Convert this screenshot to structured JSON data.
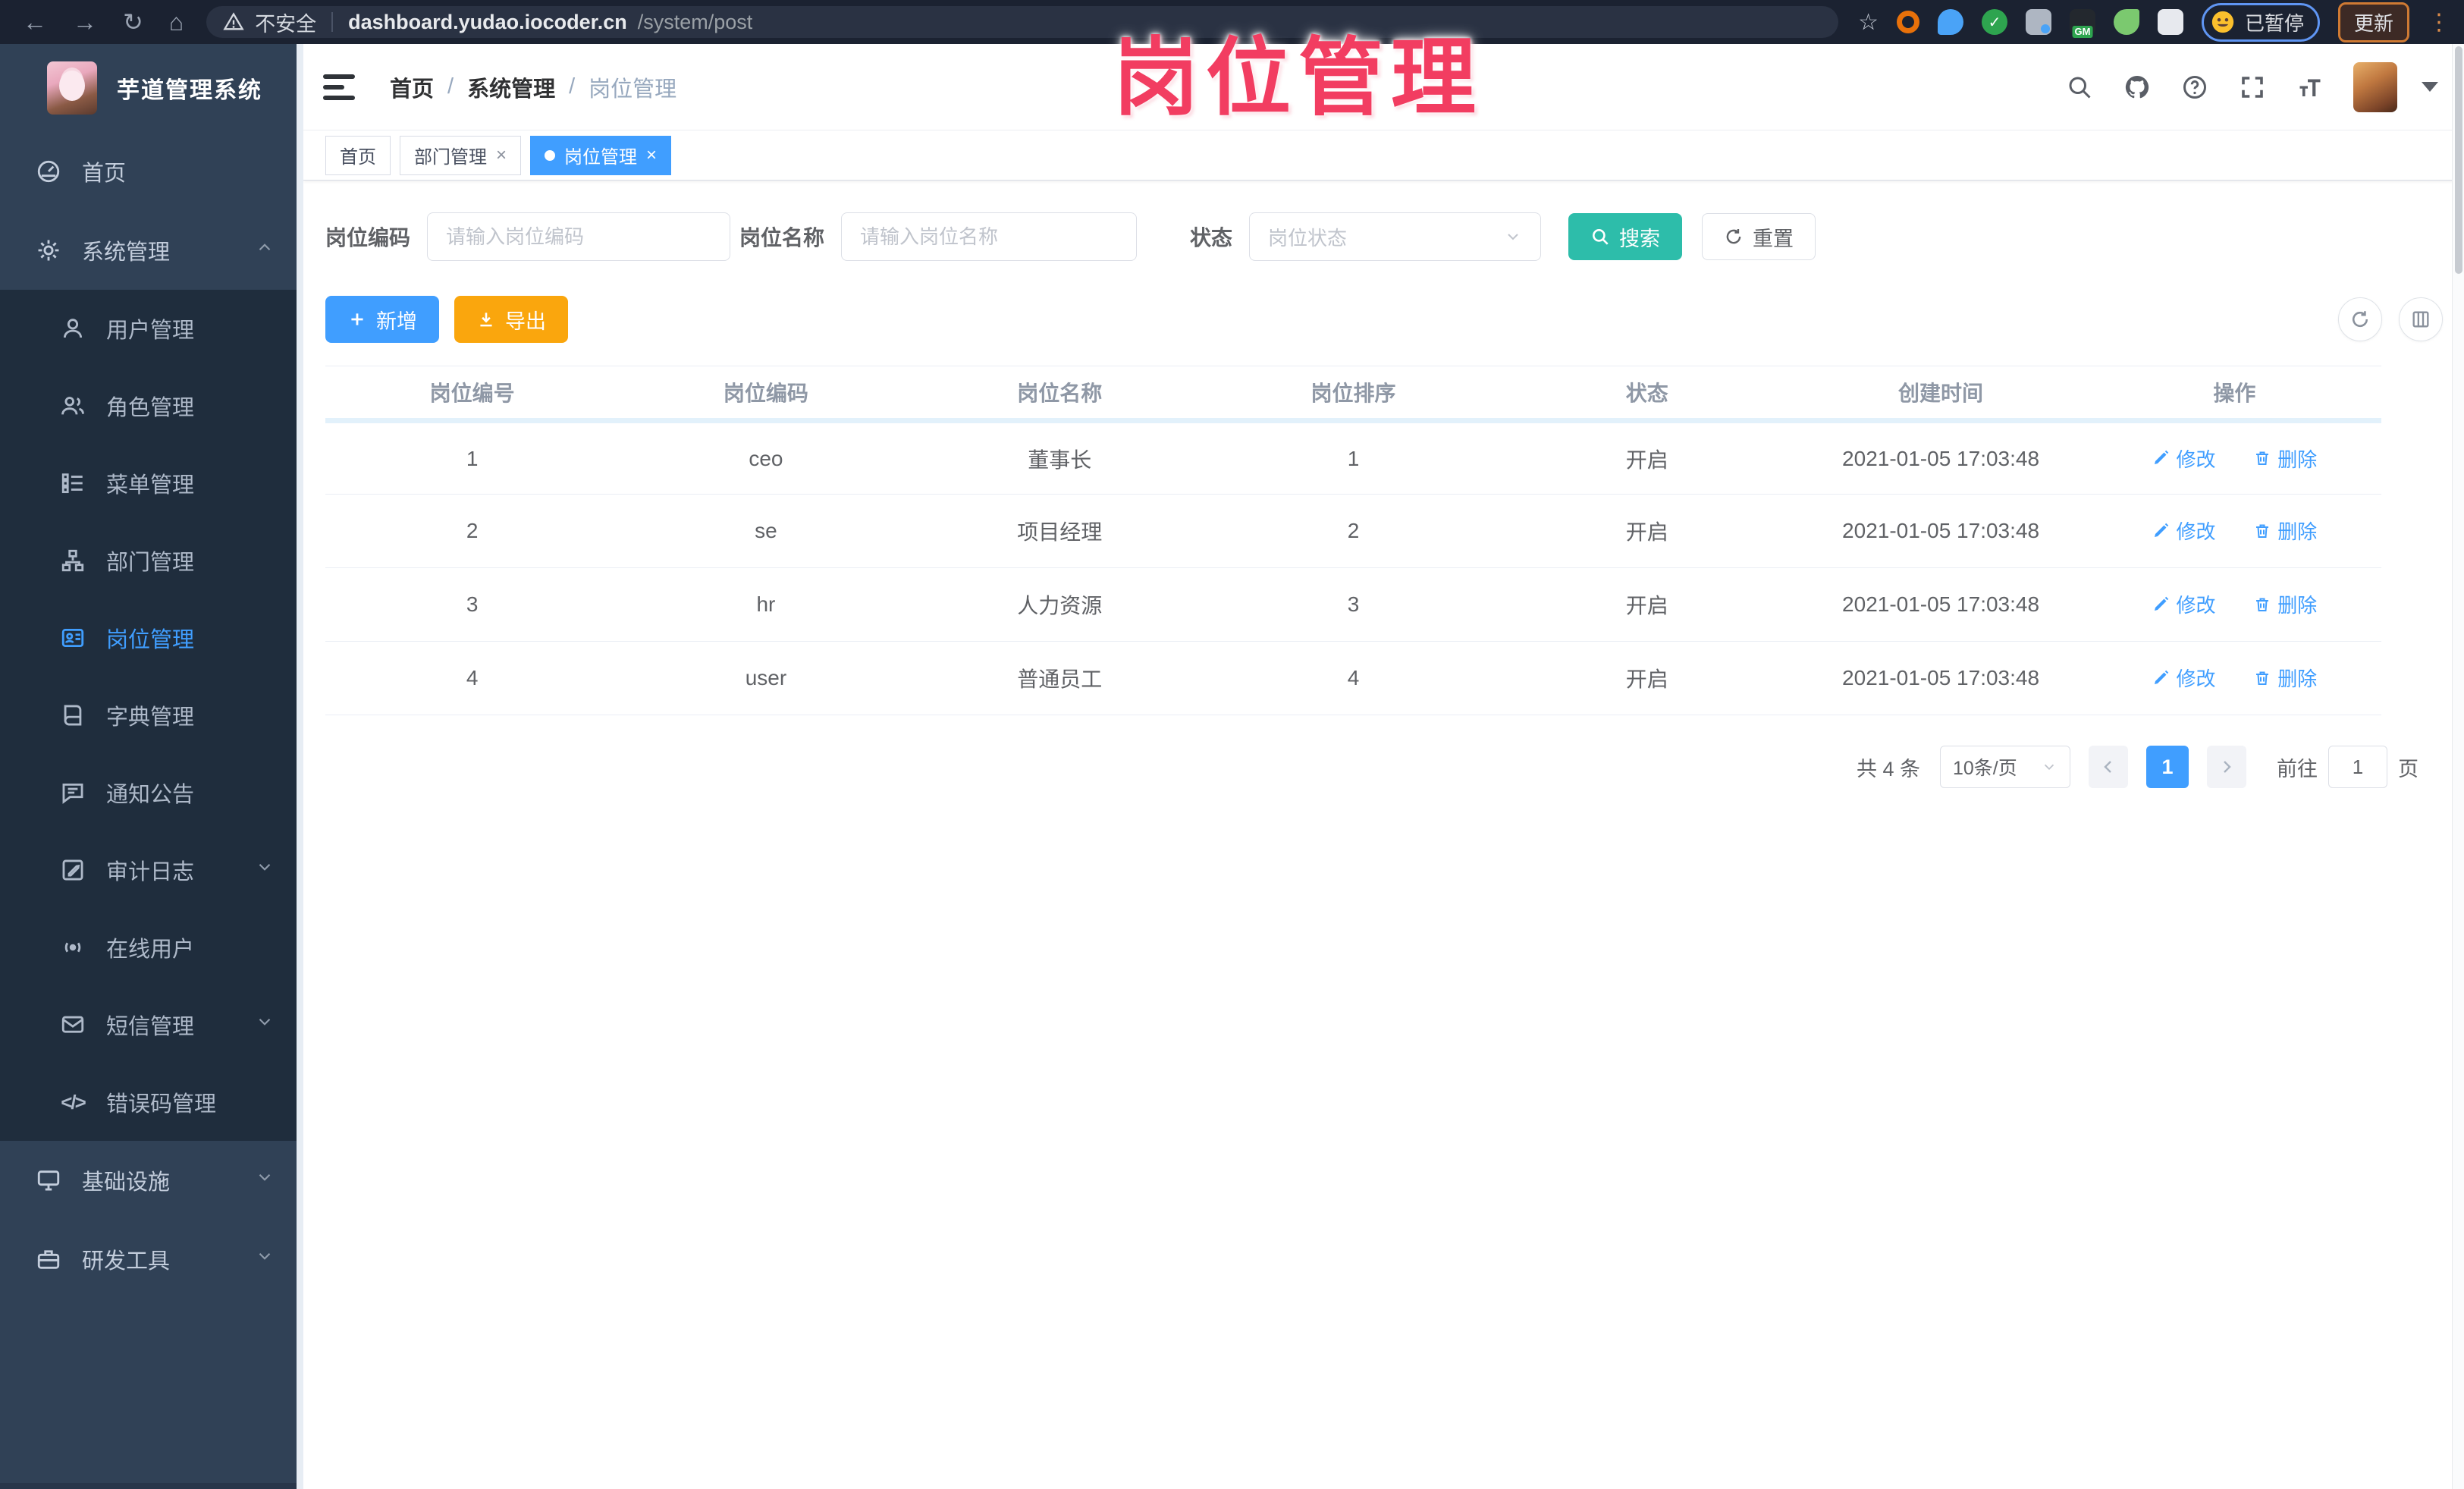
{
  "browser": {
    "security_label": "不安全",
    "url_host": "dashboard.yudao.iocoder.cn",
    "url_path": "/system/post",
    "gm_badge": "GM",
    "paused_label": "已暂停",
    "update_label": "更新"
  },
  "overlay_title": "岗位管理",
  "sidebar": {
    "app_title": "芋道管理系统",
    "items": [
      {
        "label": "首页"
      },
      {
        "label": "系统管理"
      },
      {
        "label": "用户管理"
      },
      {
        "label": "角色管理"
      },
      {
        "label": "菜单管理"
      },
      {
        "label": "部门管理"
      },
      {
        "label": "岗位管理"
      },
      {
        "label": "字典管理"
      },
      {
        "label": "通知公告"
      },
      {
        "label": "审计日志"
      },
      {
        "label": "在线用户"
      },
      {
        "label": "短信管理"
      },
      {
        "label": "错误码管理"
      },
      {
        "label": "基础设施"
      },
      {
        "label": "研发工具"
      }
    ]
  },
  "breadcrumb": {
    "items": [
      "首页",
      "系统管理",
      "岗位管理"
    ],
    "separator": "/"
  },
  "tabs": {
    "close_glyph": "×",
    "items": [
      {
        "label": "首页"
      },
      {
        "label": "部门管理"
      },
      {
        "label": "岗位管理"
      }
    ]
  },
  "filters": {
    "post_code_label": "岗位编码",
    "post_code_placeholder": "请输入岗位编码",
    "post_name_label": "岗位名称",
    "post_name_placeholder": "请输入岗位名称",
    "status_label": "状态",
    "status_placeholder": "岗位状态",
    "search_label": "搜索",
    "reset_label": "重置"
  },
  "toolbar": {
    "add_label": "新增",
    "export_label": "导出"
  },
  "table": {
    "columns": [
      "岗位编号",
      "岗位编码",
      "岗位名称",
      "岗位排序",
      "状态",
      "创建时间",
      "操作"
    ],
    "edit_label": "修改",
    "delete_label": "删除",
    "rows": [
      {
        "id": "1",
        "code": "ceo",
        "name": "董事长",
        "sort": "1",
        "status": "开启",
        "created": "2021-01-05 17:03:48"
      },
      {
        "id": "2",
        "code": "se",
        "name": "项目经理",
        "sort": "2",
        "status": "开启",
        "created": "2021-01-05 17:03:48"
      },
      {
        "id": "3",
        "code": "hr",
        "name": "人力资源",
        "sort": "3",
        "status": "开启",
        "created": "2021-01-05 17:03:48"
      },
      {
        "id": "4",
        "code": "user",
        "name": "普通员工",
        "sort": "4",
        "status": "开启",
        "created": "2021-01-05 17:03:48"
      }
    ]
  },
  "pagination": {
    "total_label": "共 4 条",
    "page_size": "10条/页",
    "current_page": "1",
    "goto_label": "前往",
    "goto_value": "1",
    "page_unit": "页"
  },
  "colors": {
    "primary": "#409eff",
    "search_teal": "#2dbdaa",
    "export_orange": "#faa60d",
    "sidebar_bg": "#304156",
    "submenu_bg": "#1f2d3d",
    "annotation_pink": "#f23d61"
  }
}
